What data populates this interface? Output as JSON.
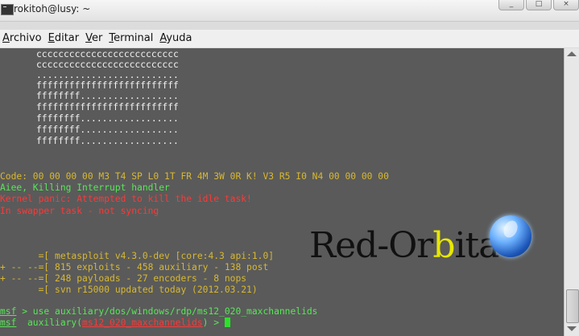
{
  "window": {
    "title": "rokitoh@lusy: ~"
  },
  "window_buttons": {
    "minimize": "_",
    "maximize": "□",
    "close": "×"
  },
  "menu": {
    "items": [
      {
        "label_first": "A",
        "label_rest": "rchivo"
      },
      {
        "label_first": "E",
        "label_rest": "ditar"
      },
      {
        "label_first": "V",
        "label_rest": "er"
      },
      {
        "label_first": "T",
        "label_rest": "erminal"
      },
      {
        "label_first": "A",
        "label_rest": "yuda"
      }
    ]
  },
  "terminal": {
    "ascii_art": [
      "cccccccccccccccccccccccccc",
      "cccccccccccccccccccccccccc",
      "..........................",
      "ffffffffffffffffffffffffff",
      "ffffffff..................",
      "ffffffffffffffffffffffffff",
      "ffffffff..................",
      "ffffffff..................",
      "ffffffff.................."
    ],
    "code_line": "Code: 00 00 00 00 M3 T4 SP L0 1T FR 4M 3W 0R K! V3 R5 I0 N4 00 00 00 00",
    "aiee_line": "Aiee, Killing Interrupt handler",
    "panic_line": "Kernel panic: Attempted to kill the idle task!",
    "swapper_line": "In swapper task - not syncing",
    "banner": [
      "       =[ metasploit v4.3.0-dev [core:4.3 api:1.0]",
      "+ -- --=[ 815 exploits - 458 auxiliary - 138 post",
      "+ -- --=[ 248 payloads - 27 encoders - 8 nops",
      "       =[ svn r15000 updated today (2012.03.21)"
    ],
    "prompt1": {
      "prefix": "msf",
      "command": " > use auxiliary/dos/windows/rdp/ms12_020_maxchannelids"
    },
    "prompt2": {
      "prefix": "msf",
      "mid": "  auxiliary(",
      "module": "ms12_020_maxchannelids",
      "suffix": ") > "
    }
  },
  "watermark": {
    "text_red": "Red-Or",
    "text_b": "b",
    "text_ita": "ita"
  },
  "colors": {
    "terminal_bg": "#5a5a5a",
    "green": "#58e658",
    "yellow": "#d8b830",
    "red": "#ff3838"
  },
  "icons": [
    "terminal-app-icon",
    "minimize-icon",
    "maximize-icon",
    "close-icon",
    "scroll-up-arrow-icon",
    "scroll-down-arrow-icon",
    "globe-icon"
  ]
}
